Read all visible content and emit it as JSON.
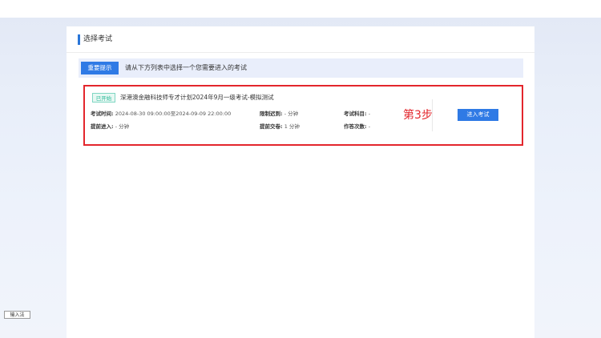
{
  "panel": {
    "title": "选择考试"
  },
  "tip": {
    "badge": "重要提示",
    "text": "请从下方列表中选择一个您需要进入的考试"
  },
  "exam": {
    "status": "已开始",
    "title": "深港澳金融科技师专才计划2024年9月一级考试-模拟测试",
    "exam_time_label": "考试时间:",
    "exam_time_value": "2024-08-30 09:00:00至2024-09-09 22:00:00",
    "late_limit_label": "限制迟到:",
    "late_limit_value": "- 分钟",
    "subject_label": "考试科目:",
    "subject_value": "-",
    "early_enter_label": "提前进入:",
    "early_enter_value": "- 分钟",
    "early_submit_label": "提前交卷:",
    "early_submit_value": "1 分钟",
    "attempts_label": "作答次数:",
    "attempts_value": "-",
    "step_annotation": "第3步",
    "enter_button": "进入考试"
  },
  "ime": {
    "label": "输入法"
  },
  "colors": {
    "accent": "#2f7ae5",
    "highlight_border": "#e3262c",
    "status_green": "#26b896"
  }
}
